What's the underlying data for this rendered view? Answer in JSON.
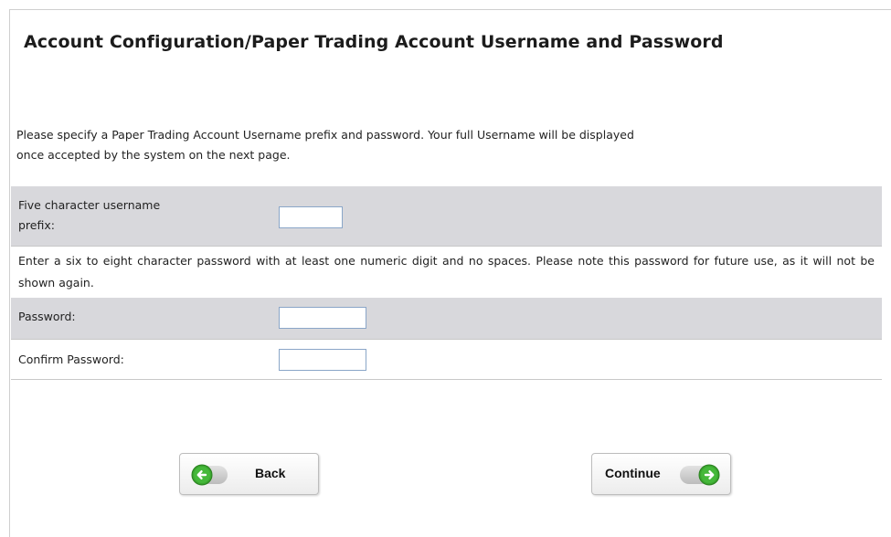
{
  "page": {
    "title": "Account Configuration/Paper Trading Account Username and Password",
    "intro_line1": "Please specify a Paper Trading Account Username prefix and password. Your full Username will be displayed",
    "intro_line2": "once accepted by the system on the next page."
  },
  "form": {
    "prefix_label_line1": "Five character username",
    "prefix_label_line2": "prefix:",
    "prefix_value": "",
    "password_note": "Enter a six to eight character password with at least one numeric digit and no spaces. Please note this password for future use, as it will not be shown again.",
    "password_label": "Password:",
    "password_value": "",
    "confirm_label": "Confirm Password:",
    "confirm_value": ""
  },
  "buttons": {
    "back_label": "Back",
    "continue_label": "Continue"
  },
  "icons": {
    "back": "arrow-left-circle-icon",
    "continue": "arrow-right-circle-icon"
  },
  "colors": {
    "row_shade": "#d8d8dc",
    "icon_green": "#3aa62e",
    "input_border": "#8aa6c8"
  }
}
